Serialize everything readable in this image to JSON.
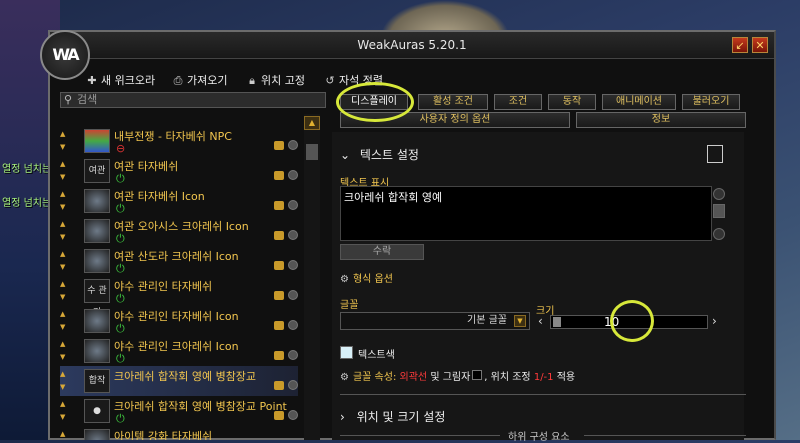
{
  "background": {
    "float_texts": [
      "열정 넘치는",
      "열정 넘치는 무역"
    ]
  },
  "window": {
    "title": "WeakAuras 5.20.1",
    "logo_text": "WA",
    "minimize_glyph": "↙",
    "close_glyph": "✕"
  },
  "toolbar": {
    "new_aura": {
      "icon": "plus-icon",
      "label": "새 위크오라"
    },
    "import": {
      "icon": "import-icon",
      "label": "가져오기"
    },
    "lock": {
      "icon": "lock-icon",
      "label": "위치 고정"
    },
    "magnet": {
      "icon": "magnet-icon",
      "label": "자석 정렬"
    }
  },
  "search": {
    "placeholder": "검색"
  },
  "aura_list": [
    {
      "name": "내부전쟁 - 타자베쉬 NPC",
      "icon_text": "",
      "style": "red"
    },
    {
      "name": "여관 타자베쉬",
      "icon_text": "여관",
      "style": "text"
    },
    {
      "name": "여관 타자베쉬 Icon",
      "icon_text": "",
      "style": "img"
    },
    {
      "name": "여관 오아시스 크아레쉬 Icon",
      "icon_text": "",
      "style": "img"
    },
    {
      "name": "여관 산도라 크아레쉬 Icon",
      "icon_text": "",
      "style": "img"
    },
    {
      "name": "야수 관리인 타자베쉬",
      "icon_text": "수 관리",
      "style": "text"
    },
    {
      "name": "야수 관리인 타자베쉬 Icon",
      "icon_text": "",
      "style": "img"
    },
    {
      "name": "야수 관리인 크아레쉬 Icon",
      "icon_text": "",
      "style": "img"
    },
    {
      "name": "크아레쉬 합작회 영예 병참장교",
      "icon_text": "합작",
      "style": "text",
      "selected": true
    },
    {
      "name": "크아레쉬 합작회 영예 병참장교 Point",
      "icon_text": "●",
      "style": "text"
    },
    {
      "name": "아이템 강화 타자베쉬",
      "icon_text": "",
      "style": "img"
    }
  ],
  "tabs_row1": [
    "디스플레이",
    "활성 조건",
    "조건",
    "동작",
    "애니메이션",
    "불러오기"
  ],
  "tabs_row2": [
    "사용자 정의 옵션",
    "정보"
  ],
  "text_settings": {
    "header": "텍스트 설정",
    "display_label": "텍스트 표시",
    "display_value": "크아레쉬 합작회 영예",
    "collapse_button": "수락",
    "format_options": "형식 옵션",
    "font_label": "글꼴",
    "font_value": "기본 글꼴",
    "size_label": "크기",
    "size_value": "10",
    "text_color_label": "텍스트색",
    "font_attr_prefix": "글꼴 속성:",
    "font_attr_outline": "외곽선",
    "font_attr_and_shadow": "및 그림자",
    "font_attr_pos": ", 위치 조정",
    "font_attr_offset": "1/-1",
    "font_attr_apply": "적용"
  },
  "position_size": {
    "header": "위치 및 크기 설정"
  },
  "sub_elements": {
    "label": "하위 구성 요소"
  },
  "colors": {
    "accent_gold": "#f2c64f",
    "highlight_ring": "#d7e83a",
    "offset_red": "#ff3b3b",
    "outline_red": "#ff3b3b"
  }
}
